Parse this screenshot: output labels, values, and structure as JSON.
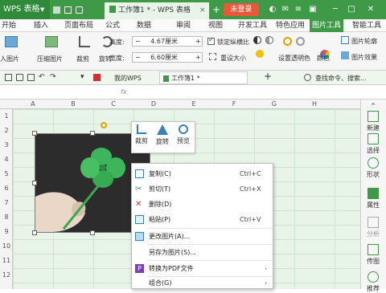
{
  "app": {
    "name": "WPS 表格",
    "doc_tab": "工作簿1 * - WPS 表格",
    "new_tab": "+",
    "login": "未登录"
  },
  "menu_tabs": [
    "开始",
    "插入",
    "页面布局",
    "公式",
    "数据",
    "审阅",
    "视图",
    "开发工具",
    "特色应用",
    "图片工具",
    "智能工具"
  ],
  "active_menu": "图片工具",
  "ribbon": {
    "insert_picture": "入图片",
    "compress_picture": "压缩图片",
    "crop": "裁剪",
    "rotate": "旋转",
    "height_label": "高度:",
    "height_value": "4.67厘米",
    "width_label": "宽度:",
    "width_value": "6.60厘米",
    "lock_ratio": "锁定纵横比",
    "reset_size": "重设大小",
    "set_transparent": "设置透明色",
    "color": "颜色",
    "picture_outline": "图片轮廓",
    "picture_effect": "图片效果",
    "minus": "−",
    "plus": "+"
  },
  "quickbar": {
    "tab1": "我的WPS",
    "tab2": "工作簿1 *",
    "tab_add": "+",
    "search": "查找命令、搜索..."
  },
  "formula_bar": {
    "fx": "fx"
  },
  "columns": [
    "A",
    "B",
    "C",
    "D",
    "E",
    "F",
    "G",
    "H"
  ],
  "rows": [
    "1",
    "2",
    "3",
    "4",
    "5",
    "6",
    "7",
    "8",
    "9",
    "10",
    "11",
    "12"
  ],
  "mini_toolbar": [
    {
      "label": "裁剪"
    },
    {
      "label": "旋转"
    },
    {
      "label": "预览"
    }
  ],
  "context_menu": [
    {
      "label": "复制(C)",
      "shortcut": "Ctrl+C"
    },
    {
      "label": "剪切(T)",
      "shortcut": "Ctrl+X"
    },
    {
      "label": "删除(D)",
      "shortcut": ""
    },
    {
      "label": "粘贴(P)",
      "shortcut": "Ctrl+V"
    },
    {
      "label": "更改图片(A)...",
      "shortcut": ""
    },
    {
      "label": "另存为图片(S)...",
      "shortcut": ""
    },
    {
      "label": "转换为PDF文件",
      "shortcut": ""
    },
    {
      "label": "组合(G)",
      "shortcut": ""
    }
  ],
  "sidebar": [
    "新建",
    "选择",
    "形状",
    "属性",
    "分析",
    "传图",
    "推荐"
  ],
  "colors": {
    "accent": "#3f9a48",
    "login": "#e8593a",
    "grid_bg": "#e8f4e8",
    "clover": "#3db55a"
  }
}
